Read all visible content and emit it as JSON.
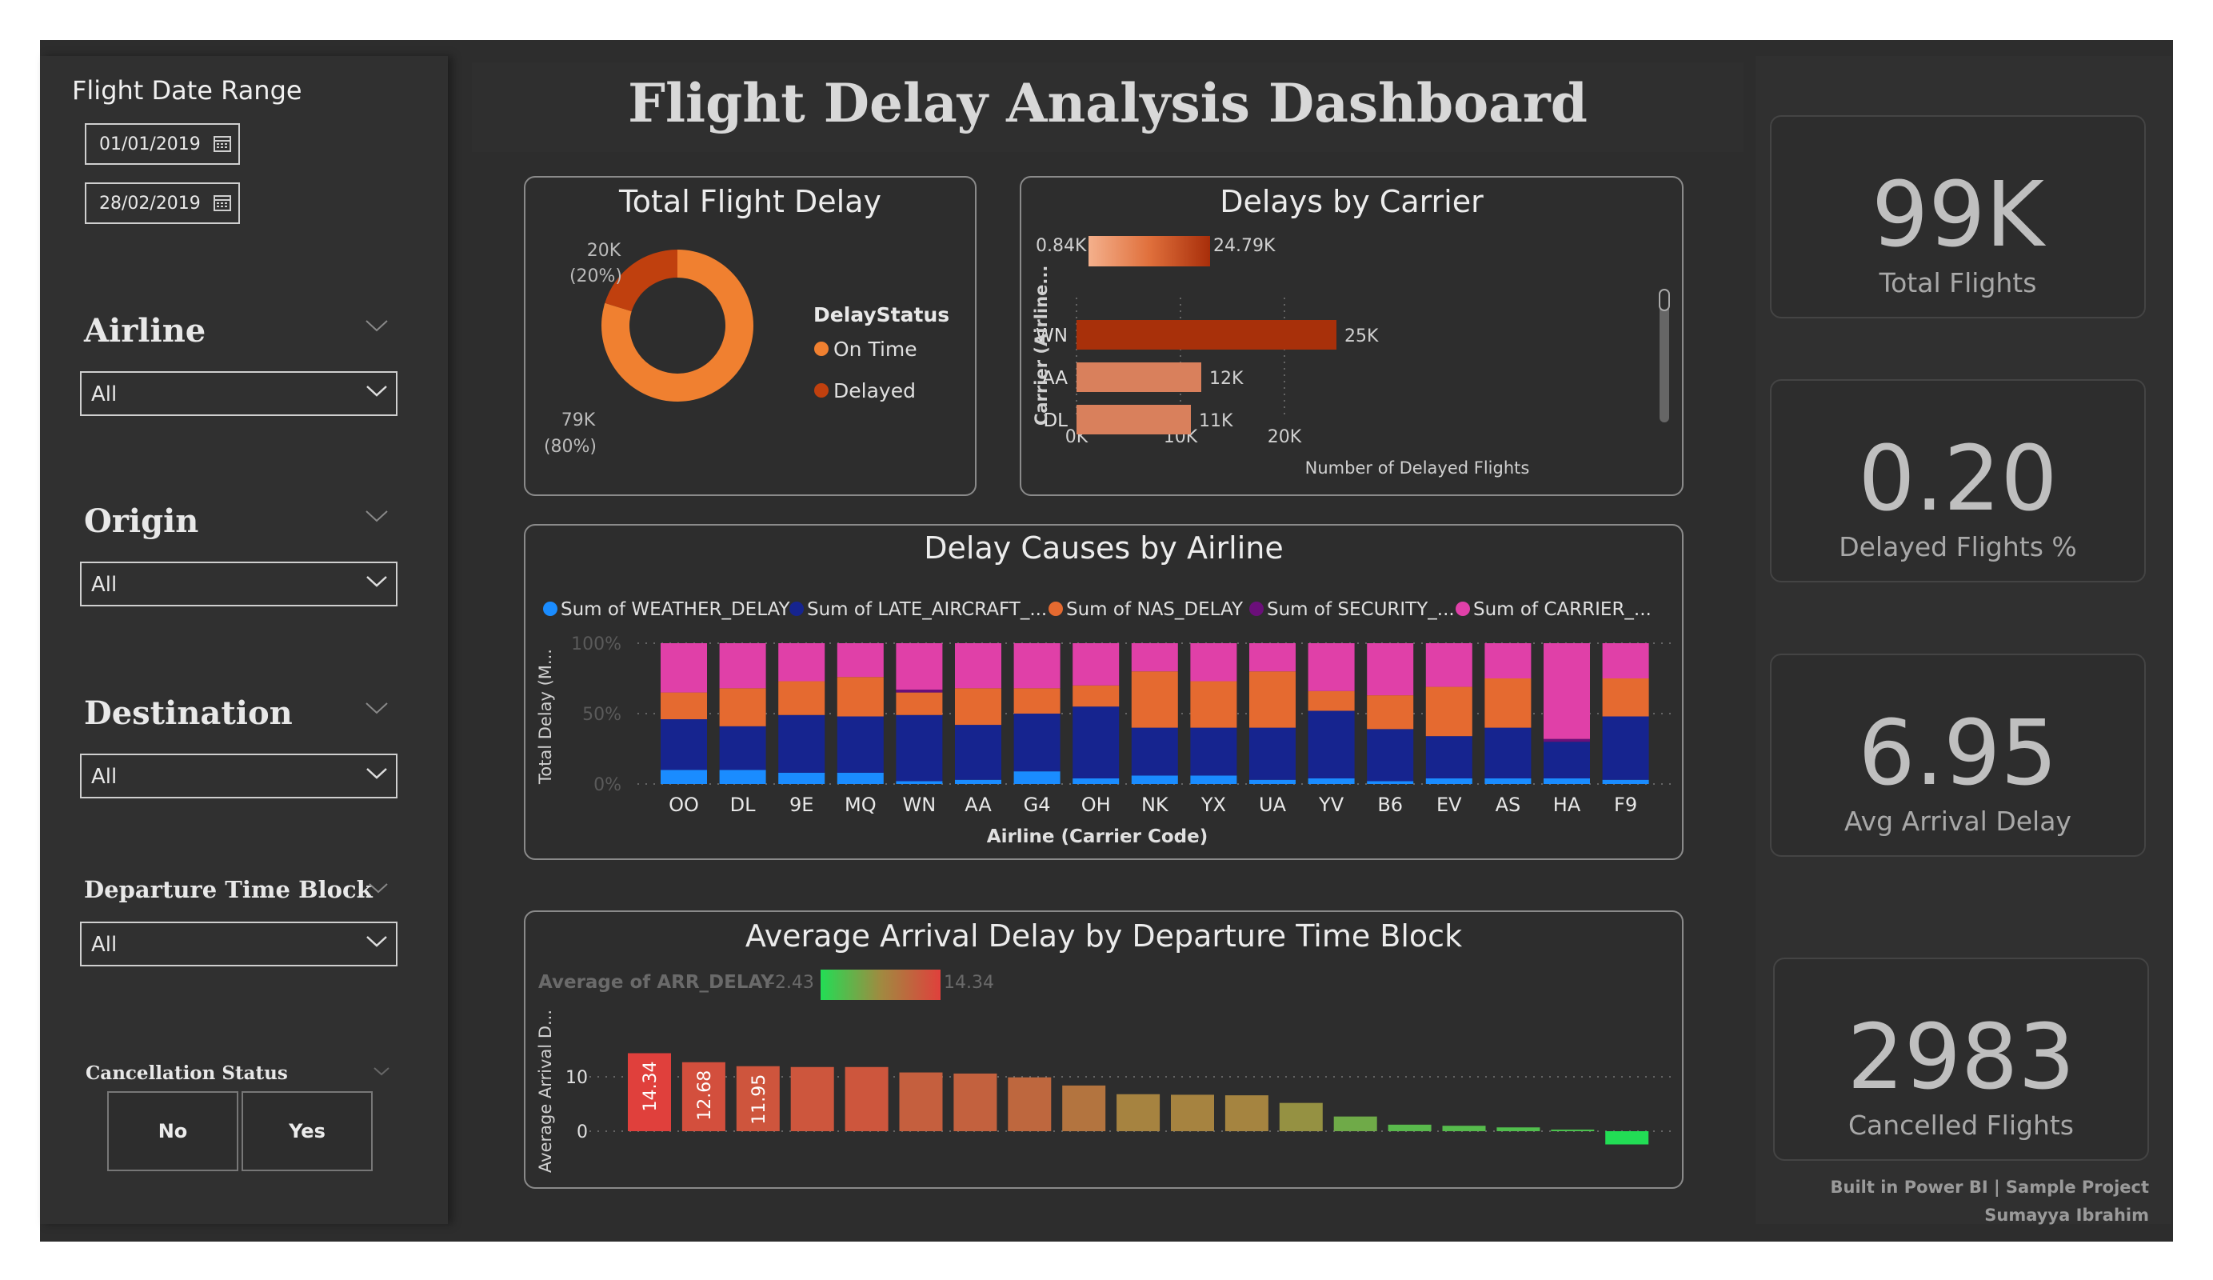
{
  "dashboard": {
    "title": "Flight Delay Analysis Dashboard",
    "footer_line1": "Built in Power BI | Sample Project",
    "footer_line2": "Sumayya Ibrahim"
  },
  "filters": {
    "date_range": {
      "label": "Flight Date Range",
      "start": "01/01/2019",
      "end": "28/02/2019"
    },
    "airline": {
      "label": "Airline",
      "value": "All"
    },
    "origin": {
      "label": "Origin",
      "value": "All"
    },
    "destination": {
      "label": "Destination",
      "value": "All"
    },
    "departure_time_block": {
      "label": "Departure Time Block",
      "value": "All"
    },
    "cancellation_status": {
      "label": "Cancellation Status",
      "options": [
        "No",
        "Yes"
      ]
    }
  },
  "kpis": [
    {
      "value": "99K",
      "label": "Total Flights"
    },
    {
      "value": "0.20",
      "label": "Delayed Flights %"
    },
    {
      "value": "6.95",
      "label": "Avg Arrival Delay"
    },
    {
      "value": "2983",
      "label": "Cancelled Flights"
    }
  ],
  "colors": {
    "on_time": "#f08030",
    "delayed": "#c0400e",
    "weather": "#1a8cff",
    "late_aircraft": "#16248f",
    "nas": "#e56a30",
    "security": "#6b0f7a",
    "carrier": "#e040a8"
  },
  "chart_data": [
    {
      "type": "pie",
      "title": "Total Flight Delay",
      "legend_title": "DelayStatus",
      "legend_position": "right",
      "categories": [
        "On Time",
        "Delayed"
      ],
      "values": [
        79,
        20
      ],
      "data_labels": [
        {
          "value": "79K",
          "pct": "(80%)"
        },
        {
          "value": "20K",
          "pct": "(20%)"
        }
      ]
    },
    {
      "type": "bar",
      "title": "Delays by Carrier",
      "orientation": "horizontal",
      "categories": [
        "WN",
        "AA",
        "DL"
      ],
      "values": [
        25,
        12,
        11
      ],
      "data_labels": [
        "25K",
        "12K",
        "11K"
      ],
      "xlabel": "Number of Delayed Flights",
      "ylabel": "Carrier (Airline...",
      "xticks": [
        "0K",
        "10K",
        "20K"
      ],
      "xlim": [
        0,
        25
      ],
      "gradient_legend": {
        "min": "0.84K",
        "max": "24.79K"
      }
    },
    {
      "type": "bar",
      "stacking": "percent",
      "title": "Delay Causes by Airline",
      "xlabel": "Airline (Carrier Code)",
      "ylabel": "Total Delay (M...",
      "yticks": [
        "0%",
        "50%",
        "100%"
      ],
      "legend_position": "top",
      "categories": [
        "OO",
        "DL",
        "9E",
        "MQ",
        "WN",
        "AA",
        "G4",
        "OH",
        "NK",
        "YX",
        "UA",
        "YV",
        "B6",
        "EV",
        "AS",
        "HA",
        "F9"
      ],
      "series": [
        {
          "name": "Sum of WEATHER_DELAY",
          "values": [
            10,
            10,
            8,
            8,
            2,
            3,
            9,
            4,
            6,
            6,
            3,
            4,
            2,
            4,
            4,
            4,
            3
          ]
        },
        {
          "name": "Sum of LATE_AIRCRAFT_...",
          "values": [
            36,
            31,
            41,
            40,
            47,
            39,
            41,
            51,
            34,
            34,
            37,
            48,
            37,
            30,
            36,
            26,
            45
          ]
        },
        {
          "name": "Sum of NAS_DELAY",
          "values": [
            19,
            27,
            24,
            28,
            16,
            26,
            18,
            15,
            40,
            33,
            40,
            14,
            24,
            35,
            35,
            0,
            27
          ]
        },
        {
          "name": "Sum of SECURITY_...",
          "values": [
            0,
            0,
            0,
            0,
            2,
            0,
            0,
            0,
            0,
            0,
            0,
            0,
            0,
            0,
            0,
            2,
            0
          ]
        },
        {
          "name": "Sum of CARRIER_...",
          "values": [
            35,
            32,
            27,
            24,
            33,
            32,
            32,
            30,
            20,
            27,
            20,
            34,
            37,
            31,
            25,
            68,
            25
          ]
        }
      ]
    },
    {
      "type": "bar",
      "title": "Average Arrival Delay by Departure Time Block",
      "ylabel": "Average Arrival D...",
      "yticks": [
        "0",
        "10"
      ],
      "values": [
        14.34,
        12.68,
        11.95,
        11.8,
        11.8,
        10.8,
        10.6,
        9.9,
        8.4,
        6.8,
        6.7,
        6.6,
        5.2,
        2.7,
        1.2,
        1.0,
        0.7,
        0.3,
        -2.43
      ],
      "data_labels": [
        "14.34",
        "12.68",
        "11.95"
      ],
      "gradient_legend": {
        "title": "Average of ARR_DELAY",
        "min": "-2.43",
        "max": "14.34"
      }
    }
  ]
}
